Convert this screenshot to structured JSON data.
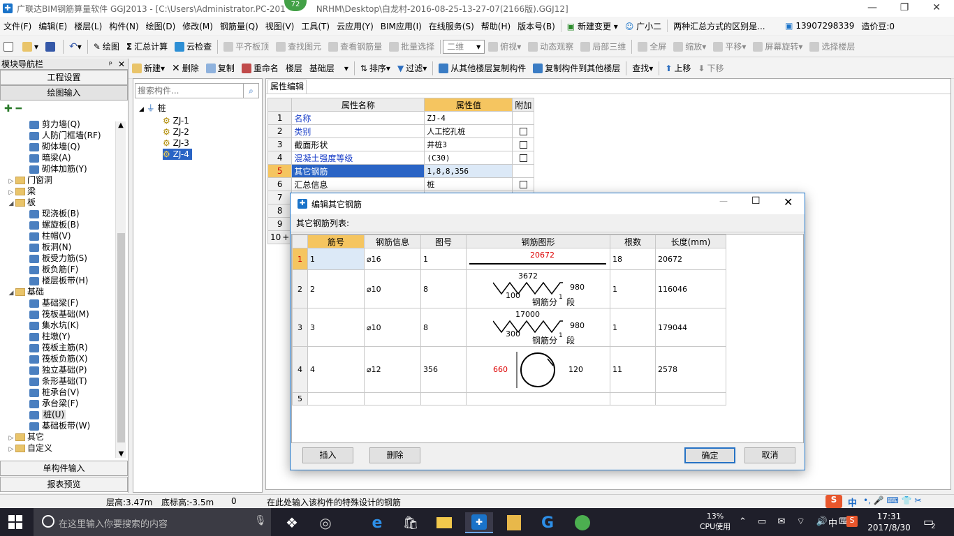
{
  "window": {
    "title": "广联达BIM钢筋算量软件 GGJ2013 - [C:\\Users\\Administrator.PC-201",
    "title_tail": "NRHM\\Desktop\\白龙村-2016-08-25-13-27-07(2166版).GGJ12]",
    "badge": "72",
    "minimize": "—",
    "maximize": "❐",
    "close": "✕"
  },
  "menu": {
    "items": [
      "文件(F)",
      "编辑(E)",
      "楼层(L)",
      "构件(N)",
      "绘图(D)",
      "修改(M)",
      "钢筋量(Q)",
      "视图(V)",
      "工具(T)",
      "云应用(Y)",
      "BIM应用(I)",
      "在线服务(S)",
      "帮助(H)",
      "版本号(B)"
    ],
    "new_change": "新建变更",
    "assistant": "广小二",
    "news": "两种汇总方式的区别是...",
    "phone": "13907298339",
    "cost_beans": "造价豆:0"
  },
  "toolbar1": {
    "draw": "绘图",
    "sum": "汇总计算",
    "cloud_check": "云检查",
    "flat_top": "平齐板顶",
    "find_elem": "查找图元",
    "view_rebar": "查看钢筋量",
    "batch_select": "批量选择",
    "view_mode": "二维",
    "top_view": "俯视",
    "dyn_view": "动态观察",
    "local_3d": "局部三维",
    "full_screen": "全屏",
    "zoom": "缩放",
    "pan": "平移",
    "rotate": "屏幕旋转",
    "select_floor": "选择楼层"
  },
  "toolbar2": {
    "new": "新建",
    "delete": "删除",
    "copy": "复制",
    "rename": "重命名",
    "floor_label": "楼层",
    "floor_value": "基础层",
    "sort": "排序",
    "filter": "过滤",
    "copy_from": "从其他楼层复制构件",
    "copy_to": "复制构件到其他楼层",
    "find": "查找",
    "move_up": "上移",
    "move_down": "下移"
  },
  "nav": {
    "header": "模块导航栏",
    "pin": "ᵖ",
    "close": "✕",
    "btn_project": "工程设置",
    "btn_draw": "绘图输入",
    "btn_single": "单构件输入",
    "btn_report": "报表预览",
    "tree": [
      {
        "label": "剪力墙(Q)",
        "type": "item"
      },
      {
        "label": "人防门框墙(RF)",
        "type": "item"
      },
      {
        "label": "砌体墙(Q)",
        "type": "item"
      },
      {
        "label": "暗梁(A)",
        "type": "item"
      },
      {
        "label": "砌体加筋(Y)",
        "type": "item"
      },
      {
        "label": "门窗洞",
        "type": "folder",
        "fold": "▷"
      },
      {
        "label": "梁",
        "type": "folder",
        "fold": "▷"
      },
      {
        "label": "板",
        "type": "folder",
        "fold": "◢"
      },
      {
        "label": "现浇板(B)",
        "type": "item"
      },
      {
        "label": "螺旋板(B)",
        "type": "item"
      },
      {
        "label": "柱帽(V)",
        "type": "item"
      },
      {
        "label": "板洞(N)",
        "type": "item"
      },
      {
        "label": "板受力筋(S)",
        "type": "item"
      },
      {
        "label": "板负筋(F)",
        "type": "item"
      },
      {
        "label": "楼层板带(H)",
        "type": "item"
      },
      {
        "label": "基础",
        "type": "folder",
        "fold": "◢"
      },
      {
        "label": "基础梁(F)",
        "type": "item"
      },
      {
        "label": "筏板基础(M)",
        "type": "item"
      },
      {
        "label": "集水坑(K)",
        "type": "item"
      },
      {
        "label": "柱墩(Y)",
        "type": "item"
      },
      {
        "label": "筏板主筋(R)",
        "type": "item"
      },
      {
        "label": "筏板负筋(X)",
        "type": "item"
      },
      {
        "label": "独立基础(P)",
        "type": "item"
      },
      {
        "label": "条形基础(T)",
        "type": "item"
      },
      {
        "label": "桩承台(V)",
        "type": "item"
      },
      {
        "label": "承台梁(F)",
        "type": "item"
      },
      {
        "label": "桩(U)",
        "type": "item",
        "selected": true
      },
      {
        "label": "基础板带(W)",
        "type": "item"
      },
      {
        "label": "其它",
        "type": "folder",
        "fold": "▷"
      },
      {
        "label": "自定义",
        "type": "folder",
        "fold": "▷"
      }
    ]
  },
  "complist": {
    "search_placeholder": "搜索构件...",
    "root": "桩",
    "items": [
      "ZJ-1",
      "ZJ-2",
      "ZJ-3",
      "ZJ-4"
    ],
    "selected": "ZJ-4"
  },
  "props": {
    "tab": "属性编辑",
    "col_name": "属性名称",
    "col_value": "属性值",
    "col_extra": "附加",
    "rows": [
      {
        "n": "1",
        "name": "名称",
        "value": "ZJ-4",
        "blue": true,
        "cb": false
      },
      {
        "n": "2",
        "name": "类别",
        "value": "人工挖孔桩",
        "blue": true,
        "cb": true
      },
      {
        "n": "3",
        "name": "截面形状",
        "value": "井桩3",
        "blue": false,
        "cb": true
      },
      {
        "n": "4",
        "name": "混凝土强度等级",
        "value": "(C30)",
        "blue": true,
        "cb": true
      },
      {
        "n": "5",
        "name": "其它钢筋",
        "value": "1,8,8,356",
        "blue": false,
        "cb": false,
        "selected": true
      },
      {
        "n": "6",
        "name": "汇总信息",
        "value": "桩",
        "blue": false,
        "cb": true
      },
      {
        "n": "7",
        "name": "",
        "value": "",
        "cb": false
      },
      {
        "n": "8",
        "name": "",
        "value": "",
        "cb": false
      },
      {
        "n": "9",
        "name": "",
        "value": "",
        "cb": false
      },
      {
        "n": "10",
        "name": "",
        "value": "",
        "cb": false,
        "plus": "+"
      }
    ]
  },
  "dialog": {
    "title": "编辑其它钢筋",
    "list_label": "其它钢筋列表:",
    "headers": [
      "筋号",
      "钢筋信息",
      "图号",
      "钢筋图形",
      "根数",
      "长度(mm)"
    ],
    "rows": [
      {
        "n": "1",
        "no": "1",
        "info": "⌀16",
        "fig": "1",
        "count": "18",
        "length": "20672",
        "shape": {
          "len": "20672"
        }
      },
      {
        "n": "2",
        "no": "2",
        "info": "⌀10",
        "fig": "8",
        "count": "1",
        "length": "116046",
        "shape": {
          "top": "3672",
          "side": "980",
          "bottom": "100",
          "label": "钢筋分",
          "sup": "1",
          "seg": "段"
        }
      },
      {
        "n": "3",
        "no": "3",
        "info": "⌀10",
        "fig": "8",
        "count": "1",
        "length": "179044",
        "shape": {
          "top": "17000",
          "side": "980",
          "bottom": "300",
          "label": "钢筋分",
          "sup": "1",
          "seg": "段"
        }
      },
      {
        "n": "4",
        "no": "4",
        "info": "⌀12",
        "fig": "356",
        "count": "11",
        "length": "2578",
        "shape": {
          "left": "660",
          "right": "120"
        }
      },
      {
        "n": "5",
        "no": "",
        "info": "",
        "fig": "",
        "count": "",
        "length": ""
      }
    ],
    "btn_insert": "插入",
    "btn_delete": "删除",
    "btn_ok": "确定",
    "btn_cancel": "取消"
  },
  "status": {
    "floor_height": "层高:3.47m",
    "bottom_elev": "底标高:-3.5m",
    "zero": "0",
    "hint": "在此处输入该构件的特殊设计的钢筋",
    "ime": "中"
  },
  "taskbar": {
    "search_placeholder": "在这里输入你要搜索的内容",
    "cpu_percent": "13%",
    "cpu_label": "CPU使用",
    "ime": "中",
    "time": "17:31",
    "date": "2017/8/30",
    "notif": "2"
  }
}
